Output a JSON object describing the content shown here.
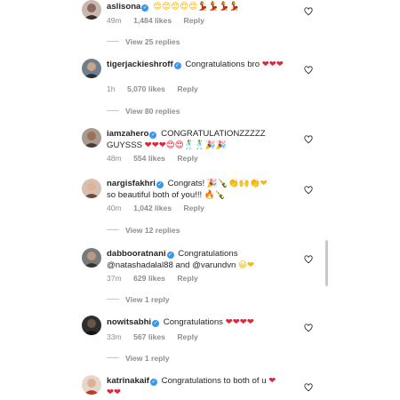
{
  "comments": [
    {
      "username": "aslisona",
      "verified": true,
      "text": "",
      "emoji": "😍😍😍😍😍💃💃💃💃",
      "time": "49m",
      "likes": "1,484 likes",
      "reply": "Reply",
      "view_replies": "View 25 replies"
    },
    {
      "username": "tigerjackieshroff",
      "verified": true,
      "text": "Congratulations bro",
      "emoji": "❤❤❤",
      "time": "1h",
      "likes": "5,070 likes",
      "reply": "Reply",
      "view_replies": "View 80 replies"
    },
    {
      "username": "iamzahero",
      "verified": true,
      "text": "CONGRATULATIONZZZZZ GUYSSS",
      "emoji": "❤❤❤😍😍🕺🕺🎉🎉",
      "time": "48m",
      "likes": "554 likes",
      "reply": "Reply",
      "view_replies": ""
    },
    {
      "username": "nargisfakhri",
      "verified": true,
      "text": "Congrats!",
      "text2": "so beautiful both of you!!!",
      "emoji": "🎉🍾👏🙌👏❤",
      "emoji2": "🔥🍾",
      "time": "40m",
      "likes": "1,042 likes",
      "reply": "Reply",
      "view_replies": "View 12 replies"
    },
    {
      "username": "dabbooratnani",
      "verified": true,
      "text": "Congratulations",
      "text2": "@natashadalal88 and @varundvn",
      "emoji": "😀❤",
      "time": "37m",
      "likes": "629 likes",
      "reply": "Reply",
      "view_replies": "View 1 reply"
    },
    {
      "username": "nowitsabhi",
      "verified": true,
      "text": "Congratulations",
      "emoji": "❤❤❤❤",
      "time": "33m",
      "likes": "567 likes",
      "reply": "Reply",
      "view_replies": "View 1 reply"
    },
    {
      "username": "katrinakaif",
      "verified": true,
      "text": "Congratulations to both of u",
      "emoji": "❤",
      "emoji2": "❤❤",
      "time": "",
      "likes": "",
      "reply": "",
      "view_replies": ""
    }
  ],
  "icons": {
    "like": "heart-outline-icon",
    "verified": "verified-badge-icon"
  },
  "colors": {
    "verified": "#3897f0",
    "meta_text": "#8e8e8e",
    "heart": "#e0263c"
  }
}
